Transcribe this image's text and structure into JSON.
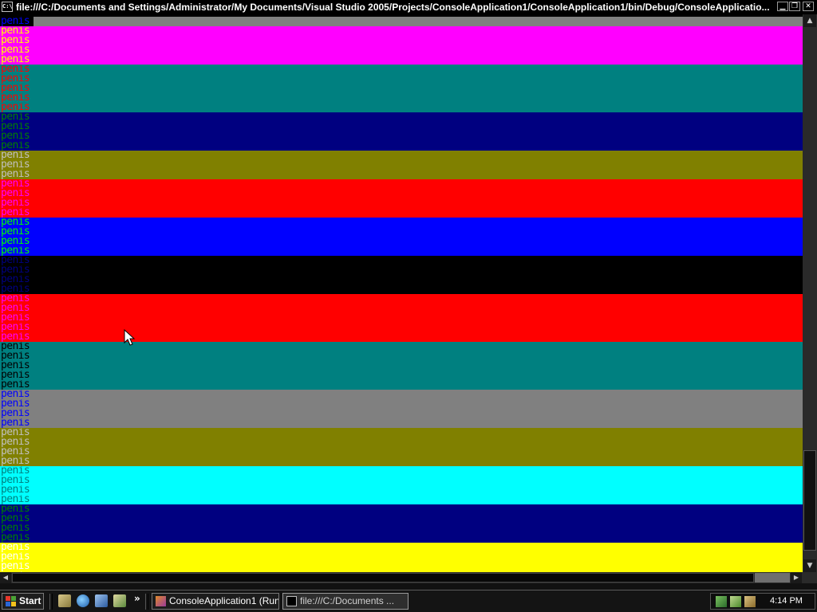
{
  "window": {
    "title": "file:///C:/Documents and Settings/Administrator/My Documents/Visual Studio 2005/Projects/ConsoleApplication1/ConsoleApplication1/bin/Debug/ConsoleApplicatio...",
    "icon_text": "C:\\",
    "minimize_glyph": "▁",
    "restore_glyph": "❐",
    "close_glyph": "✕"
  },
  "console": {
    "line_text": "penis",
    "rows": [
      {
        "fg": "#0000ff",
        "bg": "#808080",
        "label_bg": "#000000"
      },
      {
        "fg": "#ffff00",
        "bg": "#ff00ff",
        "label_bg": "#ff00ff"
      },
      {
        "fg": "#ffff00",
        "bg": "#ff00ff",
        "label_bg": "#ff00ff"
      },
      {
        "fg": "#ffff00",
        "bg": "#ff00ff",
        "label_bg": "#ff00ff"
      },
      {
        "fg": "#ffff00",
        "bg": "#ff00ff",
        "label_bg": "#ff00ff"
      },
      {
        "fg": "#ff0000",
        "bg": "#008080",
        "label_bg": "#008080"
      },
      {
        "fg": "#ff0000",
        "bg": "#008080",
        "label_bg": "#008080"
      },
      {
        "fg": "#ff0000",
        "bg": "#008080",
        "label_bg": "#008080"
      },
      {
        "fg": "#ff0000",
        "bg": "#008080",
        "label_bg": "#008080"
      },
      {
        "fg": "#ff0000",
        "bg": "#008080",
        "label_bg": "#008080"
      },
      {
        "fg": "#008000",
        "bg": "#000080",
        "label_bg": "#000080"
      },
      {
        "fg": "#008000",
        "bg": "#000080",
        "label_bg": "#000080"
      },
      {
        "fg": "#008000",
        "bg": "#000080",
        "label_bg": "#000080"
      },
      {
        "fg": "#008000",
        "bg": "#000080",
        "label_bg": "#000080"
      },
      {
        "fg": "#c0c0c0",
        "bg": "#808000",
        "label_bg": "#808000"
      },
      {
        "fg": "#c0c0c0",
        "bg": "#808000",
        "label_bg": "#808000"
      },
      {
        "fg": "#c0c0c0",
        "bg": "#808000",
        "label_bg": "#808000"
      },
      {
        "fg": "#ff00ff",
        "bg": "#ff0000",
        "label_bg": "#ff0000"
      },
      {
        "fg": "#ff00ff",
        "bg": "#ff0000",
        "label_bg": "#ff0000"
      },
      {
        "fg": "#ff00ff",
        "bg": "#ff0000",
        "label_bg": "#ff0000"
      },
      {
        "fg": "#ff00ff",
        "bg": "#ff0000",
        "label_bg": "#ff0000"
      },
      {
        "fg": "#00ff00",
        "bg": "#0000ff",
        "label_bg": "#0000ff"
      },
      {
        "fg": "#00ff00",
        "bg": "#0000ff",
        "label_bg": "#0000ff"
      },
      {
        "fg": "#00ff00",
        "bg": "#0000ff",
        "label_bg": "#0000ff"
      },
      {
        "fg": "#00ff00",
        "bg": "#0000ff",
        "label_bg": "#0000ff"
      },
      {
        "fg": "#000080",
        "bg": "#000000",
        "label_bg": "#000000"
      },
      {
        "fg": "#000080",
        "bg": "#000000",
        "label_bg": "#000000"
      },
      {
        "fg": "#000080",
        "bg": "#000000",
        "label_bg": "#000000"
      },
      {
        "fg": "#000080",
        "bg": "#000000",
        "label_bg": "#000000"
      },
      {
        "fg": "#ff00ff",
        "bg": "#ff0000",
        "label_bg": "#ff0000"
      },
      {
        "fg": "#ff00ff",
        "bg": "#ff0000",
        "label_bg": "#ff0000"
      },
      {
        "fg": "#ff00ff",
        "bg": "#ff0000",
        "label_bg": "#ff0000"
      },
      {
        "fg": "#ff00ff",
        "bg": "#ff0000",
        "label_bg": "#ff0000"
      },
      {
        "fg": "#ff00ff",
        "bg": "#ff0000",
        "label_bg": "#ff0000"
      },
      {
        "fg": "#000000",
        "bg": "#008080",
        "label_bg": "#008080"
      },
      {
        "fg": "#000000",
        "bg": "#008080",
        "label_bg": "#008080"
      },
      {
        "fg": "#000000",
        "bg": "#008080",
        "label_bg": "#008080"
      },
      {
        "fg": "#000000",
        "bg": "#008080",
        "label_bg": "#008080"
      },
      {
        "fg": "#000000",
        "bg": "#008080",
        "label_bg": "#008080"
      },
      {
        "fg": "#0000ff",
        "bg": "#808080",
        "label_bg": "#808080"
      },
      {
        "fg": "#0000ff",
        "bg": "#808080",
        "label_bg": "#808080"
      },
      {
        "fg": "#0000ff",
        "bg": "#808080",
        "label_bg": "#808080"
      },
      {
        "fg": "#0000ff",
        "bg": "#808080",
        "label_bg": "#808080"
      },
      {
        "fg": "#c0c0c0",
        "bg": "#808000",
        "label_bg": "#808000"
      },
      {
        "fg": "#c0c0c0",
        "bg": "#808000",
        "label_bg": "#808000"
      },
      {
        "fg": "#c0c0c0",
        "bg": "#808000",
        "label_bg": "#808000"
      },
      {
        "fg": "#c0c0c0",
        "bg": "#808000",
        "label_bg": "#808000"
      },
      {
        "fg": "#008080",
        "bg": "#00ffff",
        "label_bg": "#00ffff"
      },
      {
        "fg": "#008080",
        "bg": "#00ffff",
        "label_bg": "#00ffff"
      },
      {
        "fg": "#008080",
        "bg": "#00ffff",
        "label_bg": "#00ffff"
      },
      {
        "fg": "#008080",
        "bg": "#00ffff",
        "label_bg": "#00ffff"
      },
      {
        "fg": "#008000",
        "bg": "#000080",
        "label_bg": "#000080"
      },
      {
        "fg": "#008000",
        "bg": "#000080",
        "label_bg": "#000080"
      },
      {
        "fg": "#008000",
        "bg": "#000080",
        "label_bg": "#000080"
      },
      {
        "fg": "#008000",
        "bg": "#000080",
        "label_bg": "#000080"
      },
      {
        "fg": "#ffffff",
        "bg": "#ffff00",
        "label_bg": "#ffff00"
      },
      {
        "fg": "#ffffff",
        "bg": "#ffff00",
        "label_bg": "#ffff00"
      },
      {
        "fg": "#ffffff",
        "bg": "#ffff00",
        "label_bg": "#ffff00"
      },
      {
        "fg": "#ffffff",
        "bg": "#ffff00",
        "label_bg": "#ffff00"
      }
    ]
  },
  "scrollbars": {
    "vertical": {
      "up_glyph": "▲",
      "down_glyph": "▼",
      "position": 0.98
    },
    "horizontal": {
      "left_glyph": "◀",
      "right_glyph": "▶",
      "position": 0
    }
  },
  "taskbar": {
    "start_label": "Start",
    "quick_launch_more": "»",
    "tasks": [
      {
        "label": "ConsoleApplication1 (Run...",
        "icon": "visual-studio-icon",
        "active": false
      },
      {
        "label": "file:///C:/Documents ...",
        "icon": "console-icon",
        "active": true
      }
    ],
    "clock": "4:14 PM",
    "colors": {
      "logo_red": "#e8382c",
      "logo_green": "#4ca336",
      "logo_blue": "#2a66d6",
      "logo_yellow": "#f4c21c"
    }
  }
}
